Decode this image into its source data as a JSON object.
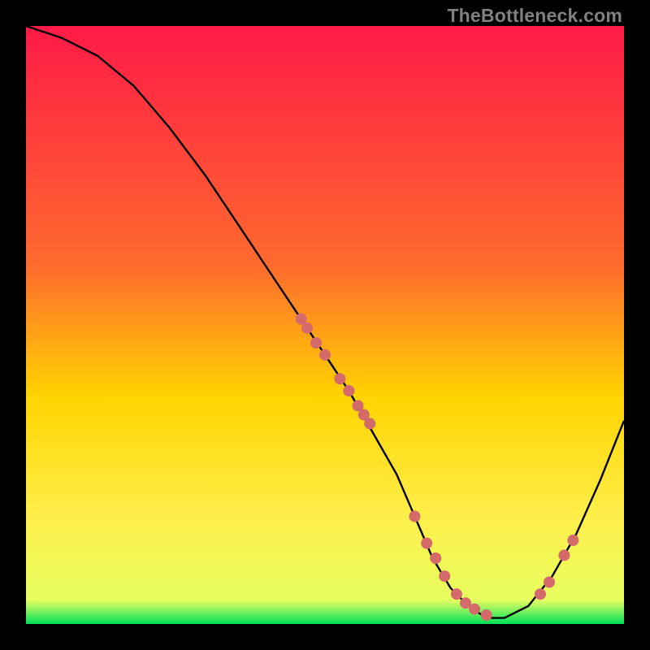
{
  "watermark": "TheBottleneck.com",
  "colors": {
    "gradient_top": "#ff1a47",
    "gradient_mid1": "#ff6a2e",
    "gradient_mid2": "#ffd400",
    "gradient_mid3": "#ffee4a",
    "gradient_bottom": "#00e05a",
    "curve_stroke": "#000000",
    "dot_fill": "#d46a6a",
    "frame": "#000000"
  },
  "chart_data": {
    "type": "line",
    "title": "",
    "xlabel": "",
    "ylabel": "",
    "xlim": [
      0,
      100
    ],
    "ylim": [
      0,
      100
    ],
    "series": [
      {
        "name": "bottleneck-curve",
        "x": [
          0,
          6,
          12,
          18,
          24,
          30,
          36,
          42,
          48,
          54,
          58,
          62,
          65,
          68,
          71,
          74,
          77,
          80,
          84,
          88,
          92,
          96,
          100
        ],
        "y": [
          100,
          98,
          95,
          90,
          83,
          75,
          66,
          57,
          48,
          39,
          32,
          25,
          18,
          11,
          6,
          3,
          1,
          1,
          3,
          8,
          15,
          24,
          34
        ]
      }
    ],
    "highlight_points": {
      "name": "dots",
      "x": [
        46,
        47,
        48.5,
        50,
        52.5,
        54,
        55.5,
        56.5,
        57.5,
        65,
        67,
        68.5,
        70,
        72,
        73.5,
        75,
        77,
        86,
        87.5,
        90,
        91.5
      ],
      "y": [
        51,
        49.5,
        47,
        45,
        41,
        39,
        36.5,
        35,
        33.5,
        18,
        13.5,
        11,
        8,
        5,
        3.5,
        2.5,
        1.5,
        5,
        7,
        11.5,
        14
      ]
    },
    "gradient_stops": [
      {
        "offset": 0,
        "color": "#ff1a47"
      },
      {
        "offset": 40,
        "color": "#ff6a2e"
      },
      {
        "offset": 62,
        "color": "#ffd400"
      },
      {
        "offset": 82,
        "color": "#ffee4a"
      },
      {
        "offset": 96,
        "color": "#e7ff60"
      },
      {
        "offset": 100,
        "color": "#00e05a"
      }
    ]
  }
}
